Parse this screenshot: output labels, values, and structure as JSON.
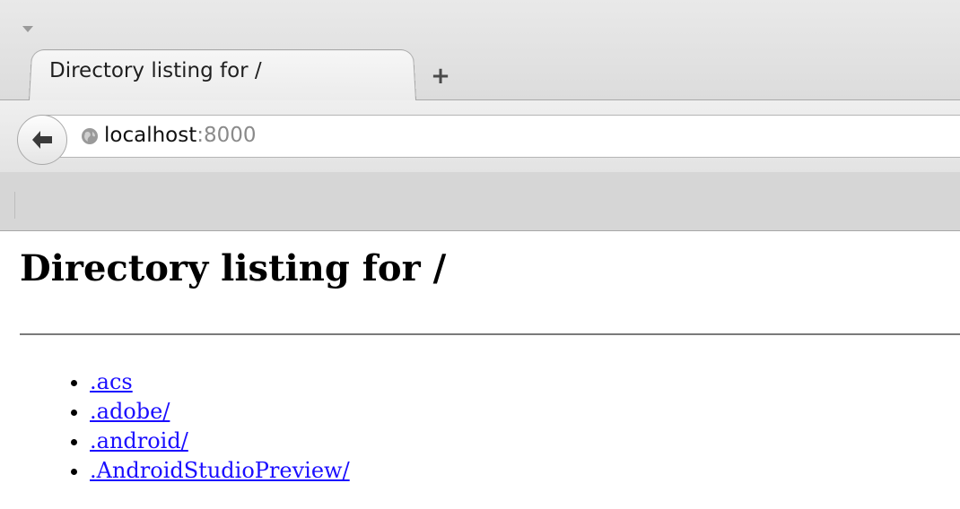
{
  "browser": {
    "tab_title": "Directory listing for /",
    "new_tab_glyph": "+",
    "url_host": "localhost",
    "url_port": ":8000"
  },
  "page": {
    "heading": "Directory listing for /",
    "entries": [
      ".acs",
      ".adobe/",
      ".android/",
      ".AndroidStudioPreview/"
    ]
  },
  "colors": {
    "link": "#1a0dff",
    "chrome_bg": "#d6d6d6"
  }
}
